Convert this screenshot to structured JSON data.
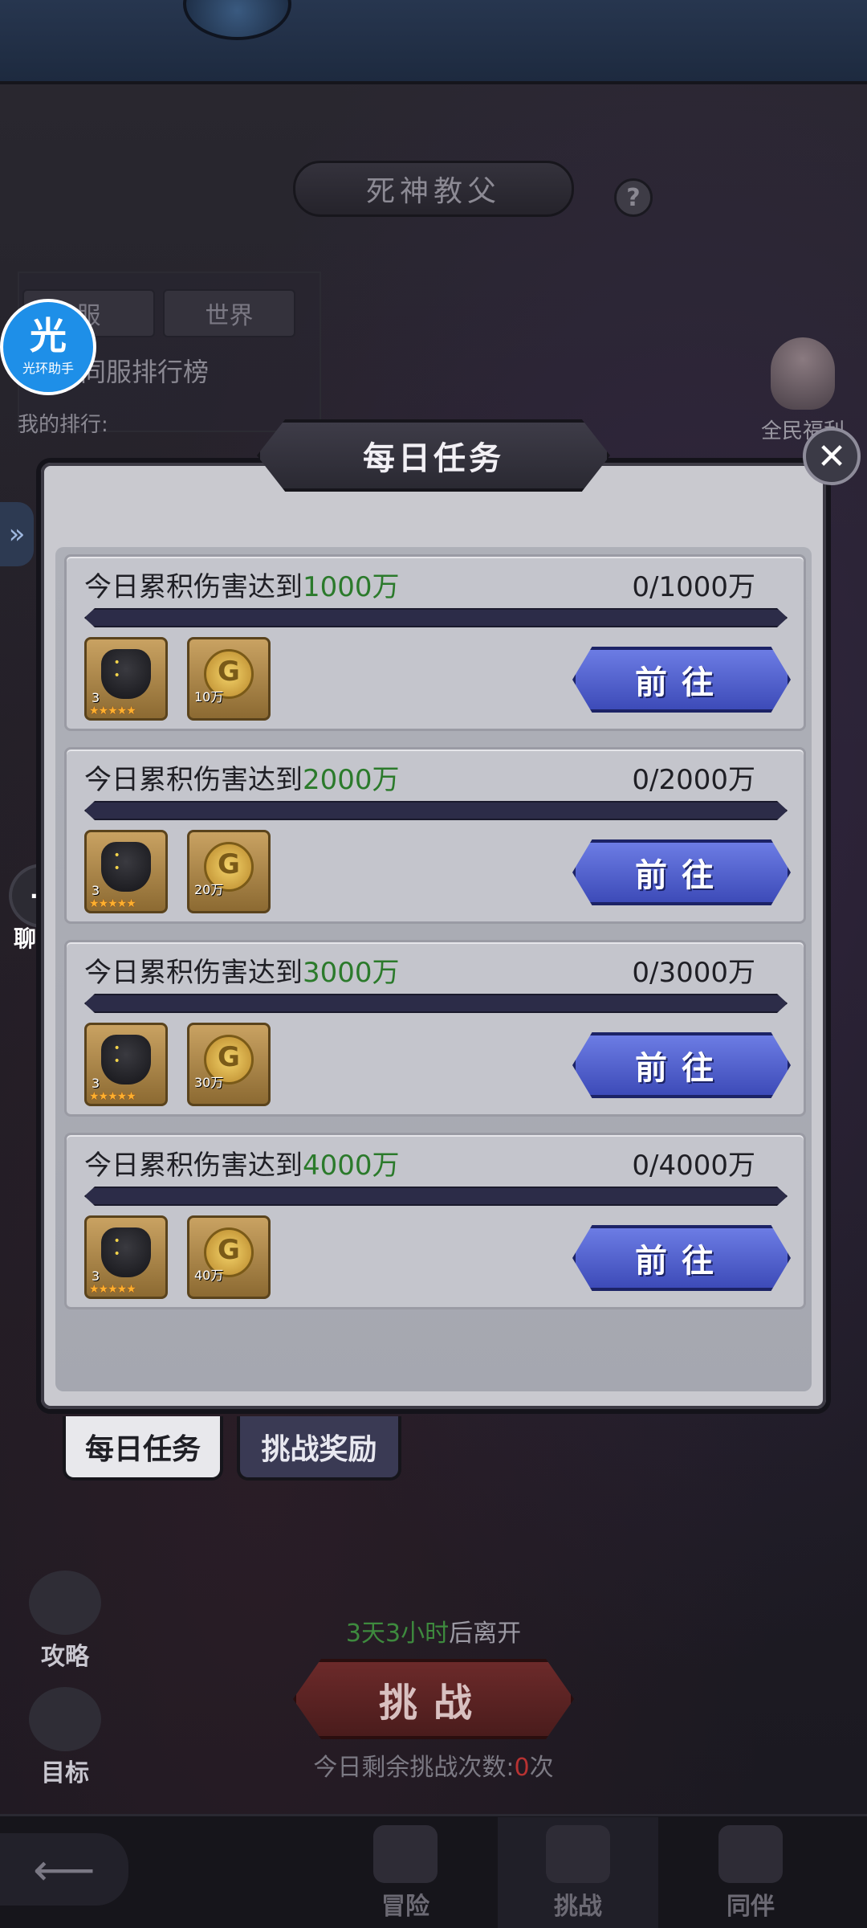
{
  "boss": {
    "title": "死神教父",
    "help_label": "?"
  },
  "ranking": {
    "tab_server": "服",
    "tab_world": "世界",
    "title": "同服排行榜",
    "my_rank_label": "我的排行:"
  },
  "assistant": {
    "icon_text": "光",
    "label": "光环助手"
  },
  "welfare": {
    "label": "全民福利"
  },
  "chat": {
    "label": "聊天",
    "icon_text": "···"
  },
  "modal": {
    "title": "每日任务",
    "close_label": "✕",
    "go_label": "前往",
    "tasks": [
      {
        "prefix": "今日累积伤害达到",
        "target": "1000万",
        "progress": "0/1000万",
        "progress_fraction": 0,
        "hero_level": "3",
        "coin_qty": "10万"
      },
      {
        "prefix": "今日累积伤害达到",
        "target": "2000万",
        "progress": "0/2000万",
        "progress_fraction": 0,
        "hero_level": "3",
        "coin_qty": "20万"
      },
      {
        "prefix": "今日累积伤害达到",
        "target": "3000万",
        "progress": "0/3000万",
        "progress_fraction": 0,
        "hero_level": "3",
        "coin_qty": "30万"
      },
      {
        "prefix": "今日累积伤害达到",
        "target": "4000万",
        "progress": "0/4000万",
        "progress_fraction": 0,
        "hero_level": "3",
        "coin_qty": "40万"
      }
    ],
    "stars": "★★★★★",
    "tabs": {
      "daily": "每日任务",
      "reward": "挑战奖励"
    }
  },
  "side": {
    "strategy": "攻略",
    "goal": "目标"
  },
  "leave": {
    "time": "3天3小时",
    "suffix": "后离开"
  },
  "challenge": {
    "label": "挑战"
  },
  "remain": {
    "prefix": "今日剩余挑战次数:",
    "count": "0",
    "suffix": "次"
  },
  "nav": {
    "adventure": "冒险",
    "challenge": "挑战",
    "partner": "同伴"
  },
  "colors": {
    "highlight_green": "#2b7a2b",
    "go_blue": "#4a5acb",
    "count_red": "#b83232"
  }
}
